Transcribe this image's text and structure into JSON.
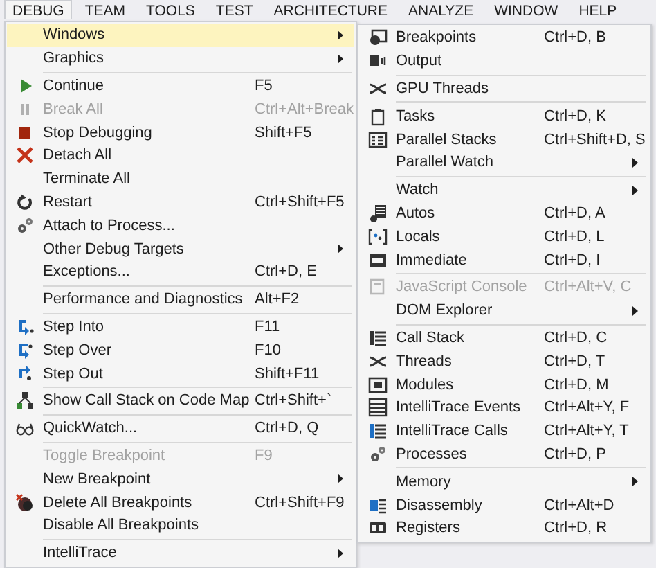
{
  "menubar": [
    {
      "label": "DEBUG",
      "selected": true
    },
    {
      "label": "TEAM",
      "selected": false
    },
    {
      "label": "TOOLS",
      "selected": false
    },
    {
      "label": "TEST",
      "selected": false
    },
    {
      "label": "ARCHITECTURE",
      "selected": false
    },
    {
      "label": "ANALYZE",
      "selected": false
    },
    {
      "label": "WINDOW",
      "selected": false
    },
    {
      "label": "HELP",
      "selected": false
    }
  ],
  "menu": {
    "groups": [
      [
        {
          "label": "Windows",
          "submenu": true,
          "selected": true,
          "disabled": false
        },
        {
          "label": "Graphics",
          "submenu": true,
          "selected": false,
          "disabled": false
        }
      ],
      [
        {
          "label": "Continue",
          "shortcut": "F5",
          "selected": false,
          "disabled": false
        },
        {
          "label": "Break All",
          "shortcut": "Ctrl+Alt+Break",
          "selected": false,
          "disabled": true
        },
        {
          "label": "Stop Debugging",
          "shortcut": "Shift+F5",
          "selected": false,
          "disabled": false
        },
        {
          "label": "Detach All",
          "selected": false,
          "disabled": false
        },
        {
          "label": "Terminate All",
          "selected": false,
          "disabled": false
        },
        {
          "label": "Restart",
          "shortcut": "Ctrl+Shift+F5",
          "selected": false,
          "disabled": false
        },
        {
          "label": "Attach to Process...",
          "selected": false,
          "disabled": false
        },
        {
          "label": "Other Debug Targets",
          "submenu": true,
          "selected": false,
          "disabled": false
        },
        {
          "label": "Exceptions...",
          "shortcut": "Ctrl+D, E",
          "selected": false,
          "disabled": false
        }
      ],
      [
        {
          "label": "Performance and Diagnostics",
          "shortcut": "Alt+F2",
          "selected": false,
          "disabled": false
        }
      ],
      [
        {
          "label": "Step Into",
          "shortcut": "F11",
          "selected": false,
          "disabled": false
        },
        {
          "label": "Step Over",
          "shortcut": "F10",
          "selected": false,
          "disabled": false
        },
        {
          "label": "Step Out",
          "shortcut": "Shift+F11",
          "selected": false,
          "disabled": false
        }
      ],
      [
        {
          "label": "Show Call Stack on Code Map",
          "shortcut": "Ctrl+Shift+`",
          "selected": false,
          "disabled": false
        }
      ],
      [
        {
          "label": "QuickWatch...",
          "shortcut": "Ctrl+D, Q",
          "selected": false,
          "disabled": false
        }
      ],
      [
        {
          "label": "Toggle Breakpoint",
          "shortcut": "F9",
          "selected": false,
          "disabled": true
        },
        {
          "label": "New Breakpoint",
          "submenu": true,
          "selected": false,
          "disabled": false
        },
        {
          "label": "Delete All Breakpoints",
          "shortcut": "Ctrl+Shift+F9",
          "selected": false,
          "disabled": false
        },
        {
          "label": "Disable All Breakpoints",
          "selected": false,
          "disabled": false
        }
      ],
      [
        {
          "label": "IntelliTrace",
          "submenu": true,
          "selected": false,
          "disabled": false
        }
      ]
    ]
  },
  "windows_submenu": {
    "groups": [
      [
        {
          "label": "Breakpoints",
          "shortcut": "Ctrl+D, B",
          "selected": false,
          "disabled": false
        },
        {
          "label": "Output",
          "selected": false,
          "disabled": false
        }
      ],
      [
        {
          "label": "GPU Threads",
          "selected": false,
          "disabled": false
        }
      ],
      [
        {
          "label": "Tasks",
          "shortcut": "Ctrl+D, K",
          "selected": false,
          "disabled": false
        },
        {
          "label": "Parallel Stacks",
          "shortcut": "Ctrl+Shift+D, S",
          "selected": false,
          "disabled": false
        },
        {
          "label": "Parallel Watch",
          "submenu": true,
          "selected": false,
          "disabled": false
        }
      ],
      [
        {
          "label": "Watch",
          "submenu": true,
          "selected": false,
          "disabled": false
        },
        {
          "label": "Autos",
          "shortcut": "Ctrl+D, A",
          "selected": false,
          "disabled": false
        },
        {
          "label": "Locals",
          "shortcut": "Ctrl+D, L",
          "selected": false,
          "disabled": false
        },
        {
          "label": "Immediate",
          "shortcut": "Ctrl+D, I",
          "selected": false,
          "disabled": false
        }
      ],
      [
        {
          "label": "JavaScript Console",
          "shortcut": "Ctrl+Alt+V, C",
          "selected": false,
          "disabled": true
        },
        {
          "label": "DOM Explorer",
          "submenu": true,
          "selected": false,
          "disabled": false
        }
      ],
      [
        {
          "label": "Call Stack",
          "shortcut": "Ctrl+D, C",
          "selected": false,
          "disabled": false
        },
        {
          "label": "Threads",
          "shortcut": "Ctrl+D, T",
          "selected": false,
          "disabled": false
        },
        {
          "label": "Modules",
          "shortcut": "Ctrl+D, M",
          "selected": false,
          "disabled": false
        },
        {
          "label": "IntelliTrace Events",
          "shortcut": "Ctrl+Alt+Y, F",
          "selected": false,
          "disabled": false
        },
        {
          "label": "IntelliTrace Calls",
          "shortcut": "Ctrl+Alt+Y, T",
          "selected": false,
          "disabled": false
        },
        {
          "label": "Processes",
          "shortcut": "Ctrl+D, P",
          "selected": false,
          "disabled": false
        }
      ],
      [
        {
          "label": "Memory",
          "submenu": true,
          "selected": false,
          "disabled": false
        },
        {
          "label": "Disassembly",
          "shortcut": "Ctrl+Alt+D",
          "selected": false,
          "disabled": false
        },
        {
          "label": "Registers",
          "shortcut": "Ctrl+D, R",
          "selected": false,
          "disabled": false
        }
      ]
    ]
  }
}
